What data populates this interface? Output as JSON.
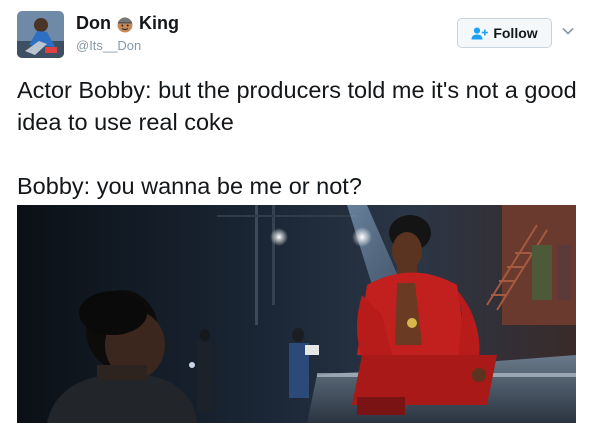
{
  "user": {
    "name_first": "Don",
    "name_second": "King",
    "name_emoji": "face-emoji",
    "handle": "@Its__Don"
  },
  "follow": {
    "label": "Follow",
    "icon": "add-user-icon"
  },
  "menu": {
    "icon": "chevron-down-icon"
  },
  "tweet": {
    "line1": "Actor Bobby: but the producers told me it's not a good idea to use real coke",
    "line2": "Bobby: you wanna be me or not?"
  },
  "colors": {
    "text": "#14171a",
    "muted": "#8899a6",
    "follow_icon": "#1da1f2",
    "button_border": "#c7d4de"
  }
}
